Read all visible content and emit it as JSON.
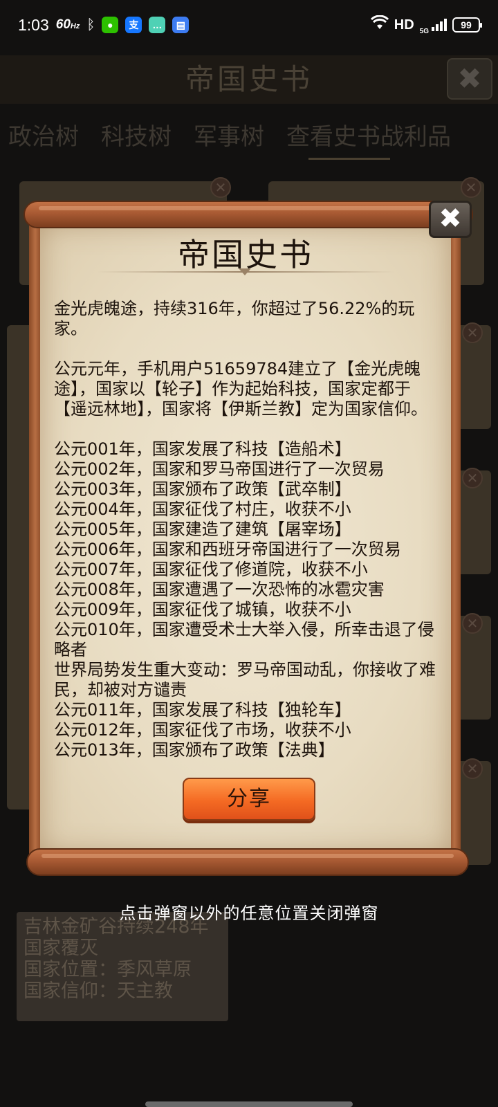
{
  "status_bar": {
    "time": "1:03",
    "refresh_rate": "60",
    "refresh_unit": "Hz",
    "network": "HD",
    "network_gen": "5G",
    "battery": "99"
  },
  "background": {
    "title": "帝国史书",
    "tabs": [
      "政治树",
      "科技树",
      "军事树",
      "查看史书战利品"
    ],
    "info_card": {
      "line1": "吉林金矿谷持续248年",
      "line2": "国家覆灭",
      "line3": "国家位置：季风草原",
      "line4": "国家信仰：天主教"
    }
  },
  "dialog": {
    "title": "帝国史书",
    "intro": "金光虎魄途，持续316年，你超过了56.22%的玩家。",
    "founding": "公元元年，手机用户51659784建立了【金光虎魄途】，国家以【轮子】作为起始科技，国家定都于【遥远林地】，国家将【伊斯兰教】定为国家信仰。",
    "events": [
      "公元001年，国家发展了科技【造船术】",
      "公元002年，国家和罗马帝国进行了一次贸易",
      "公元003年，国家颁布了政策【武卒制】",
      "公元004年，国家征伐了村庄，收获不小",
      "公元005年，国家建造了建筑【屠宰场】",
      "公元006年，国家和西班牙帝国进行了一次贸易",
      "公元007年，国家征伐了修道院，收获不小",
      "公元008年，国家遭遇了一次恐怖的冰雹灾害",
      "公元009年，国家征伐了城镇，收获不小",
      "公元010年，国家遭受术士大举入侵，所幸击退了侵略者",
      "世界局势发生重大变动：罗马帝国动乱，你接收了难民，却被对方谴责",
      "公元011年，国家发展了科技【独轮车】",
      "公元012年，国家征伐了市场，收获不小",
      "公元013年，国家颁布了政策【法典】"
    ],
    "share_label": "分享"
  },
  "hint": "点击弹窗以外的任意位置关闭弹窗"
}
